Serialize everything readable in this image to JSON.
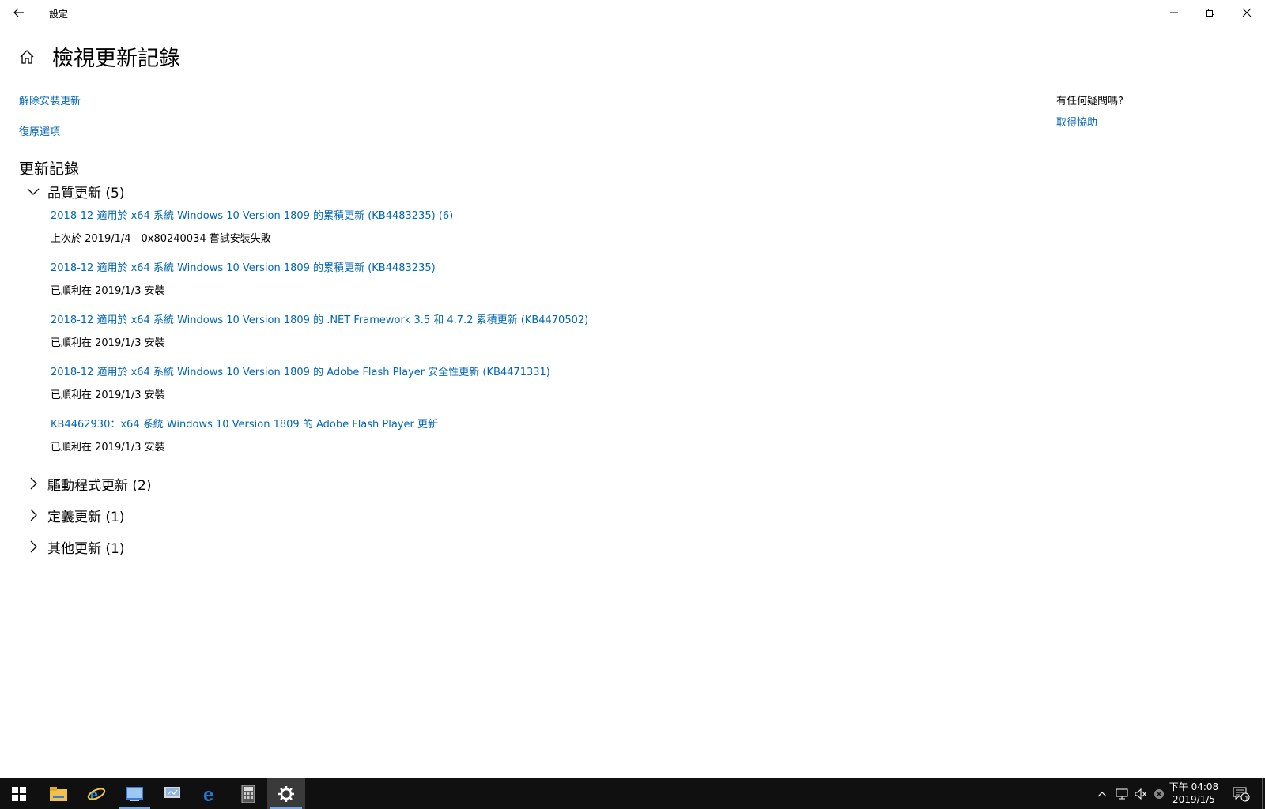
{
  "window": {
    "title": "設定",
    "minimize_icon": "minimize-icon",
    "maximize_icon": "restore-icon",
    "close_icon": "close-icon"
  },
  "header": {
    "page_title": "檢視更新記錄"
  },
  "links": {
    "uninstall": "解除安裝更新",
    "recovery": "復原選項"
  },
  "help": {
    "question": "有任何疑問嗎?",
    "get_help": "取得協助"
  },
  "history": {
    "section_title": "更新記錄",
    "groups": [
      {
        "label": "品質更新 (5)",
        "expanded": true,
        "items": [
          {
            "title": "2018-12 適用於 x64 系統 Windows 10 Version 1809 的累積更新 (KB4483235) (6)",
            "status": "上次於 2019/1/4 - 0x80240034 嘗試安裝失敗"
          },
          {
            "title": "2018-12 適用於 x64 系統 Windows 10 Version 1809 的累積更新 (KB4483235)",
            "status": "已順利在 2019/1/3 安裝"
          },
          {
            "title": "2018-12 適用於 x64 系統 Windows 10 Version 1809 的 .NET Framework 3.5 和 4.7.2 累積更新 (KB4470502)",
            "status": "已順利在 2019/1/3 安裝"
          },
          {
            "title": "2018-12 適用於 x64 系統 Windows 10 Version 1809 的 Adobe Flash Player 安全性更新 (KB4471331)",
            "status": "已順利在 2019/1/3 安裝"
          },
          {
            "title": "KB4462930：x64 系統 Windows 10 Version 1809 的 Adobe Flash Player 更新",
            "status": "已順利在 2019/1/3 安裝"
          }
        ]
      },
      {
        "label": "驅動程式更新 (2)",
        "expanded": false
      },
      {
        "label": "定義更新 (1)",
        "expanded": false
      },
      {
        "label": "其他更新 (1)",
        "expanded": false
      }
    ]
  },
  "taskbar": {
    "apps": [
      "start-icon",
      "file-explorer-icon",
      "internet-explorer-icon",
      "control-panel-icon",
      "network-icon",
      "edge-icon",
      "calculator-icon",
      "settings-icon"
    ],
    "clock_time": "下午 04:08",
    "clock_date": "2019/1/5",
    "notification_count": "1",
    "accent_color": "#7aa7dc"
  },
  "colors": {
    "link": "#0066b4",
    "taskbar_bg": "#101010"
  }
}
